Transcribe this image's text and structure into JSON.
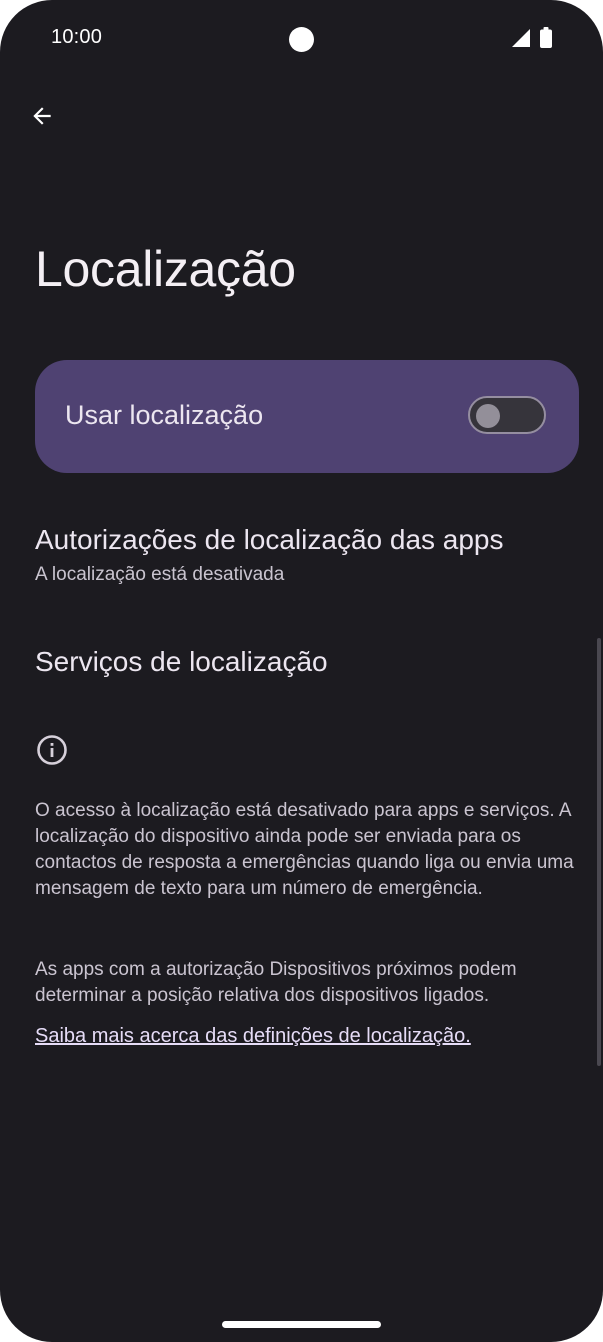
{
  "status_bar": {
    "time": "10:00",
    "icons": [
      "signal-icon",
      "battery-icon"
    ]
  },
  "toolbar": {
    "back_icon": "arrow-back-icon"
  },
  "page": {
    "title": "Localização"
  },
  "main_switch": {
    "label": "Usar localização",
    "checked": false
  },
  "preferences": [
    {
      "title": "Autorizações de localização das apps",
      "summary": "A localização está desativada"
    },
    {
      "title": "Serviços de localização"
    }
  ],
  "footer": {
    "icon": "info-icon",
    "paragraph_1": "O acesso à localização está desativado para apps e serviços. A localização do dispositivo ainda pode ser enviada para os contactos de resposta a emergências quando liga ou envia uma mensagem de texto para um número de emergência.",
    "paragraph_2": "As apps com a autorização Dispositivos próximos podem determinar a posição relativa dos dispositivos ligados.",
    "link": "Saiba mais acerca das definições de localização."
  },
  "colors": {
    "background": "#1c1b20",
    "switch_card": "#4f4272",
    "text_primary": "#ece6f0",
    "text_secondary": "#c9c4cf"
  }
}
